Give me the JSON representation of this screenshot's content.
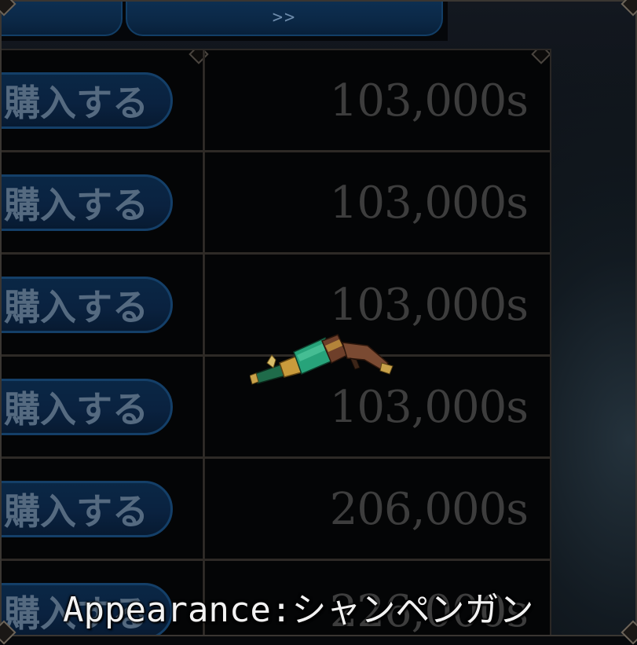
{
  "tabs": {
    "next_label": ">>"
  },
  "rows": [
    {
      "buy_label": "購入する",
      "price": "103,000s"
    },
    {
      "buy_label": "購入する",
      "price": "103,000s"
    },
    {
      "buy_label": "購入する",
      "price": "103,000s"
    },
    {
      "buy_label": "購入する",
      "price": "103,000s"
    },
    {
      "buy_label": "購入する",
      "price": "206,000s"
    },
    {
      "buy_label": "購入する",
      "price": "226,000s"
    }
  ],
  "preview": {
    "item_icon": "champagne-gun-icon",
    "caption": "Appearance:シャンペンガン"
  },
  "colors": {
    "button_fill": "#0a2745",
    "button_border": "#143f68",
    "price_text": "#3d3d3d",
    "caption_text": "#f2f2f2"
  }
}
